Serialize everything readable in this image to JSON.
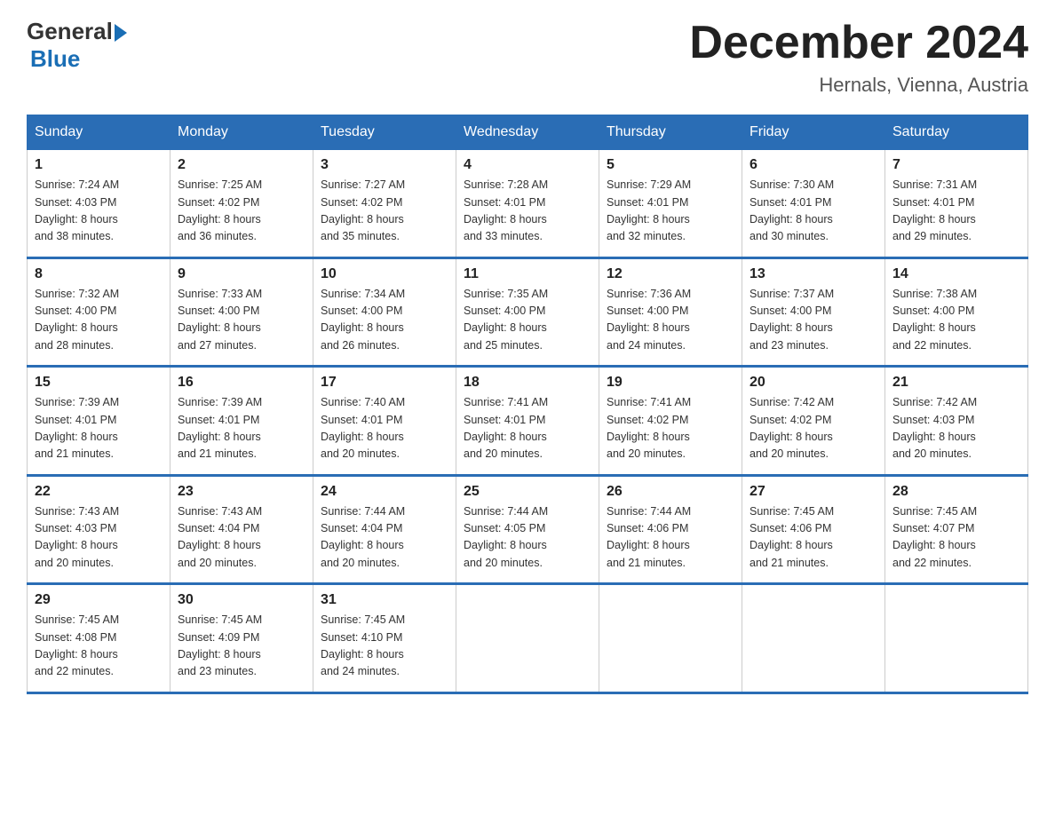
{
  "header": {
    "logo": {
      "general": "General",
      "blue": "Blue"
    },
    "title": "December 2024",
    "subtitle": "Hernals, Vienna, Austria"
  },
  "weekdays": [
    "Sunday",
    "Monday",
    "Tuesday",
    "Wednesday",
    "Thursday",
    "Friday",
    "Saturday"
  ],
  "weeks": [
    [
      {
        "day": "1",
        "sunrise": "Sunrise: 7:24 AM",
        "sunset": "Sunset: 4:03 PM",
        "daylight": "Daylight: 8 hours",
        "daylight2": "and 38 minutes."
      },
      {
        "day": "2",
        "sunrise": "Sunrise: 7:25 AM",
        "sunset": "Sunset: 4:02 PM",
        "daylight": "Daylight: 8 hours",
        "daylight2": "and 36 minutes."
      },
      {
        "day": "3",
        "sunrise": "Sunrise: 7:27 AM",
        "sunset": "Sunset: 4:02 PM",
        "daylight": "Daylight: 8 hours",
        "daylight2": "and 35 minutes."
      },
      {
        "day": "4",
        "sunrise": "Sunrise: 7:28 AM",
        "sunset": "Sunset: 4:01 PM",
        "daylight": "Daylight: 8 hours",
        "daylight2": "and 33 minutes."
      },
      {
        "day": "5",
        "sunrise": "Sunrise: 7:29 AM",
        "sunset": "Sunset: 4:01 PM",
        "daylight": "Daylight: 8 hours",
        "daylight2": "and 32 minutes."
      },
      {
        "day": "6",
        "sunrise": "Sunrise: 7:30 AM",
        "sunset": "Sunset: 4:01 PM",
        "daylight": "Daylight: 8 hours",
        "daylight2": "and 30 minutes."
      },
      {
        "day": "7",
        "sunrise": "Sunrise: 7:31 AM",
        "sunset": "Sunset: 4:01 PM",
        "daylight": "Daylight: 8 hours",
        "daylight2": "and 29 minutes."
      }
    ],
    [
      {
        "day": "8",
        "sunrise": "Sunrise: 7:32 AM",
        "sunset": "Sunset: 4:00 PM",
        "daylight": "Daylight: 8 hours",
        "daylight2": "and 28 minutes."
      },
      {
        "day": "9",
        "sunrise": "Sunrise: 7:33 AM",
        "sunset": "Sunset: 4:00 PM",
        "daylight": "Daylight: 8 hours",
        "daylight2": "and 27 minutes."
      },
      {
        "day": "10",
        "sunrise": "Sunrise: 7:34 AM",
        "sunset": "Sunset: 4:00 PM",
        "daylight": "Daylight: 8 hours",
        "daylight2": "and 26 minutes."
      },
      {
        "day": "11",
        "sunrise": "Sunrise: 7:35 AM",
        "sunset": "Sunset: 4:00 PM",
        "daylight": "Daylight: 8 hours",
        "daylight2": "and 25 minutes."
      },
      {
        "day": "12",
        "sunrise": "Sunrise: 7:36 AM",
        "sunset": "Sunset: 4:00 PM",
        "daylight": "Daylight: 8 hours",
        "daylight2": "and 24 minutes."
      },
      {
        "day": "13",
        "sunrise": "Sunrise: 7:37 AM",
        "sunset": "Sunset: 4:00 PM",
        "daylight": "Daylight: 8 hours",
        "daylight2": "and 23 minutes."
      },
      {
        "day": "14",
        "sunrise": "Sunrise: 7:38 AM",
        "sunset": "Sunset: 4:00 PM",
        "daylight": "Daylight: 8 hours",
        "daylight2": "and 22 minutes."
      }
    ],
    [
      {
        "day": "15",
        "sunrise": "Sunrise: 7:39 AM",
        "sunset": "Sunset: 4:01 PM",
        "daylight": "Daylight: 8 hours",
        "daylight2": "and 21 minutes."
      },
      {
        "day": "16",
        "sunrise": "Sunrise: 7:39 AM",
        "sunset": "Sunset: 4:01 PM",
        "daylight": "Daylight: 8 hours",
        "daylight2": "and 21 minutes."
      },
      {
        "day": "17",
        "sunrise": "Sunrise: 7:40 AM",
        "sunset": "Sunset: 4:01 PM",
        "daylight": "Daylight: 8 hours",
        "daylight2": "and 20 minutes."
      },
      {
        "day": "18",
        "sunrise": "Sunrise: 7:41 AM",
        "sunset": "Sunset: 4:01 PM",
        "daylight": "Daylight: 8 hours",
        "daylight2": "and 20 minutes."
      },
      {
        "day": "19",
        "sunrise": "Sunrise: 7:41 AM",
        "sunset": "Sunset: 4:02 PM",
        "daylight": "Daylight: 8 hours",
        "daylight2": "and 20 minutes."
      },
      {
        "day": "20",
        "sunrise": "Sunrise: 7:42 AM",
        "sunset": "Sunset: 4:02 PM",
        "daylight": "Daylight: 8 hours",
        "daylight2": "and 20 minutes."
      },
      {
        "day": "21",
        "sunrise": "Sunrise: 7:42 AM",
        "sunset": "Sunset: 4:03 PM",
        "daylight": "Daylight: 8 hours",
        "daylight2": "and 20 minutes."
      }
    ],
    [
      {
        "day": "22",
        "sunrise": "Sunrise: 7:43 AM",
        "sunset": "Sunset: 4:03 PM",
        "daylight": "Daylight: 8 hours",
        "daylight2": "and 20 minutes."
      },
      {
        "day": "23",
        "sunrise": "Sunrise: 7:43 AM",
        "sunset": "Sunset: 4:04 PM",
        "daylight": "Daylight: 8 hours",
        "daylight2": "and 20 minutes."
      },
      {
        "day": "24",
        "sunrise": "Sunrise: 7:44 AM",
        "sunset": "Sunset: 4:04 PM",
        "daylight": "Daylight: 8 hours",
        "daylight2": "and 20 minutes."
      },
      {
        "day": "25",
        "sunrise": "Sunrise: 7:44 AM",
        "sunset": "Sunset: 4:05 PM",
        "daylight": "Daylight: 8 hours",
        "daylight2": "and 20 minutes."
      },
      {
        "day": "26",
        "sunrise": "Sunrise: 7:44 AM",
        "sunset": "Sunset: 4:06 PM",
        "daylight": "Daylight: 8 hours",
        "daylight2": "and 21 minutes."
      },
      {
        "day": "27",
        "sunrise": "Sunrise: 7:45 AM",
        "sunset": "Sunset: 4:06 PM",
        "daylight": "Daylight: 8 hours",
        "daylight2": "and 21 minutes."
      },
      {
        "day": "28",
        "sunrise": "Sunrise: 7:45 AM",
        "sunset": "Sunset: 4:07 PM",
        "daylight": "Daylight: 8 hours",
        "daylight2": "and 22 minutes."
      }
    ],
    [
      {
        "day": "29",
        "sunrise": "Sunrise: 7:45 AM",
        "sunset": "Sunset: 4:08 PM",
        "daylight": "Daylight: 8 hours",
        "daylight2": "and 22 minutes."
      },
      {
        "day": "30",
        "sunrise": "Sunrise: 7:45 AM",
        "sunset": "Sunset: 4:09 PM",
        "daylight": "Daylight: 8 hours",
        "daylight2": "and 23 minutes."
      },
      {
        "day": "31",
        "sunrise": "Sunrise: 7:45 AM",
        "sunset": "Sunset: 4:10 PM",
        "daylight": "Daylight: 8 hours",
        "daylight2": "and 24 minutes."
      },
      null,
      null,
      null,
      null
    ]
  ]
}
